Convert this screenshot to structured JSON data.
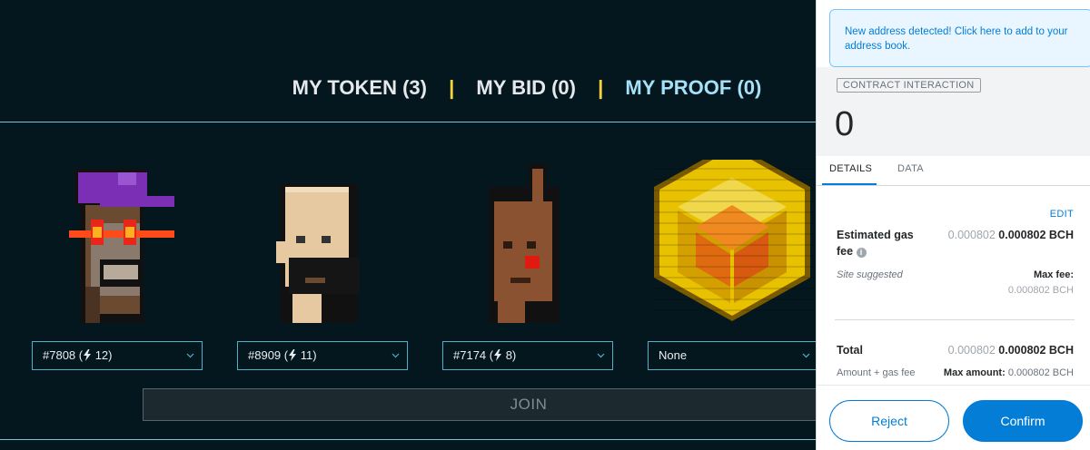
{
  "dapp": {
    "tabs": [
      {
        "label": "MY TOKEN (3)"
      },
      {
        "label": "MY BID (0)"
      },
      {
        "label": "MY PROOF (0)"
      }
    ],
    "separator": "|",
    "selects": [
      {
        "text": "#7808 (",
        "count": " 12)"
      },
      {
        "text": "#8909 (",
        "count": " 11)"
      },
      {
        "text": "#7174 (",
        "count": " 8)"
      },
      {
        "text": "None",
        "count": ""
      }
    ],
    "join_label": "JOIN"
  },
  "metamask": {
    "notice": "New address detected! Click here to add to your address book.",
    "badge": "CONTRACT INTERACTION",
    "amount": "0",
    "tabs": {
      "details": "DETAILS",
      "data": "DATA"
    },
    "edit": "EDIT",
    "gas": {
      "label_line1": "Estimated gas",
      "label_line2": "fee",
      "suggested": "Site suggested",
      "value_gray": "0.000802",
      "value_bold": "0.000802 BCH",
      "max_fee_label": "Max fee:",
      "max_fee_value": "0.000802 BCH"
    },
    "total": {
      "label": "Total",
      "sublabel": "Amount + gas fee",
      "value_gray": "0.000802",
      "value_bold": "0.000802 BCH",
      "max_amount_label": "Max amount:",
      "max_amount_value": "0.000802 BCH"
    },
    "buttons": {
      "reject": "Reject",
      "confirm": "Confirm"
    }
  },
  "colors": {
    "bg": "#04171e",
    "tab_active": "#a5e2f7",
    "separator": "#f3d23b",
    "accent_blue": "#037dd6"
  }
}
